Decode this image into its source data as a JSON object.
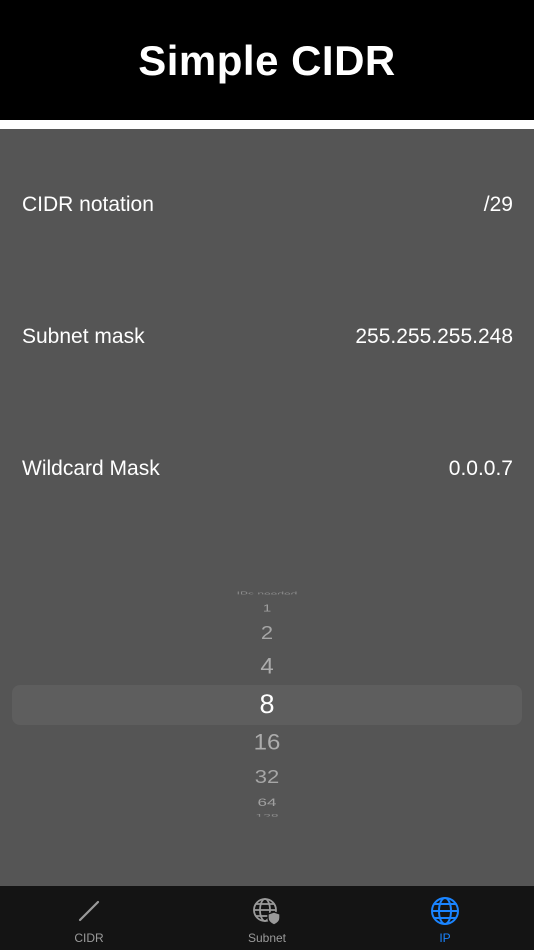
{
  "app": {
    "title": "Simple CIDR"
  },
  "results": {
    "cidr_label": "CIDR notation",
    "cidr_value": "/29",
    "subnet_label": "Subnet mask",
    "subnet_value": "255.255.255.248",
    "wildcard_label": "Wildcard Mask",
    "wildcard_value": "0.0.0.7"
  },
  "picker": {
    "header": "IPs needed",
    "items": [
      "1",
      "2",
      "4",
      "8",
      "16",
      "32",
      "64",
      "128"
    ],
    "selected": "8"
  },
  "tabs": [
    {
      "label": "CIDR",
      "icon": "slash-icon",
      "active": false
    },
    {
      "label": "Subnet",
      "icon": "globe-shield-icon",
      "active": false
    },
    {
      "label": "IP",
      "icon": "globe-icon",
      "active": true
    }
  ],
  "colors": {
    "header_bg": "#000000",
    "content_bg": "#555555",
    "tabbar_bg": "#141414",
    "active_tab": "#1a84ff",
    "inactive_tab": "#9a9a9a"
  }
}
